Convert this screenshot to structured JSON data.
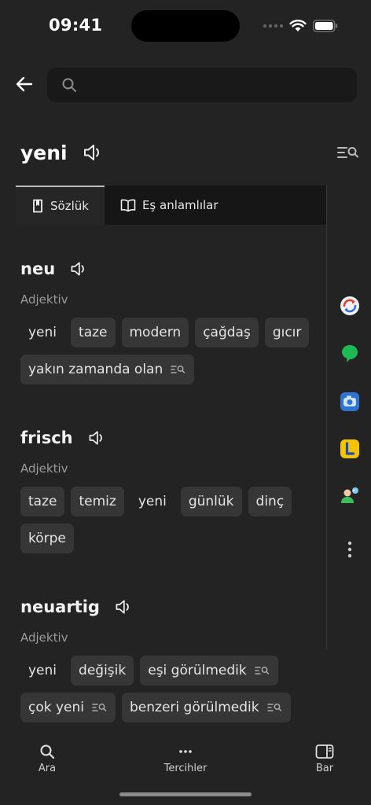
{
  "status": {
    "time": "09:41"
  },
  "search": {
    "placeholder": ""
  },
  "headword": {
    "text": "yeni"
  },
  "tabs": [
    {
      "label": "Sözlük",
      "icon": "book-icon",
      "active": true
    },
    {
      "label": "Eş anlamlılar",
      "icon": "open-book-icon",
      "active": false
    }
  ],
  "entries": [
    {
      "word": "neu",
      "pos": "Adjektiv",
      "chips": [
        "yeni",
        "taze",
        "modern",
        "çağdaş",
        "gıcır",
        "yakın zamanda olan"
      ]
    },
    {
      "word": "frisch",
      "pos": "Adjektiv",
      "chips": [
        "taze",
        "temiz",
        "yeni",
        "günlük",
        "dinç",
        "körpe"
      ]
    },
    {
      "word": "neuartig",
      "pos": "Adjektiv",
      "chips": [
        "yeni",
        "değişik",
        "eşi görülmedik",
        "çok yeni",
        "benzeri görülmedik"
      ]
    }
  ],
  "side_apps": [
    "translate-app-icon",
    "chat-app-icon",
    "camera-app-icon",
    "lingo-app-icon",
    "contacts-app-icon",
    "more-vertical-icon"
  ],
  "nav": [
    {
      "label": "Ara",
      "icon": "search-icon"
    },
    {
      "label": "Tercihler",
      "icon": "more-horizontal-icon"
    },
    {
      "label": "Bar",
      "icon": "sidebar-icon"
    }
  ],
  "colors": {
    "background": "#232323",
    "chip": "#363636",
    "tabbar": "#161616"
  }
}
